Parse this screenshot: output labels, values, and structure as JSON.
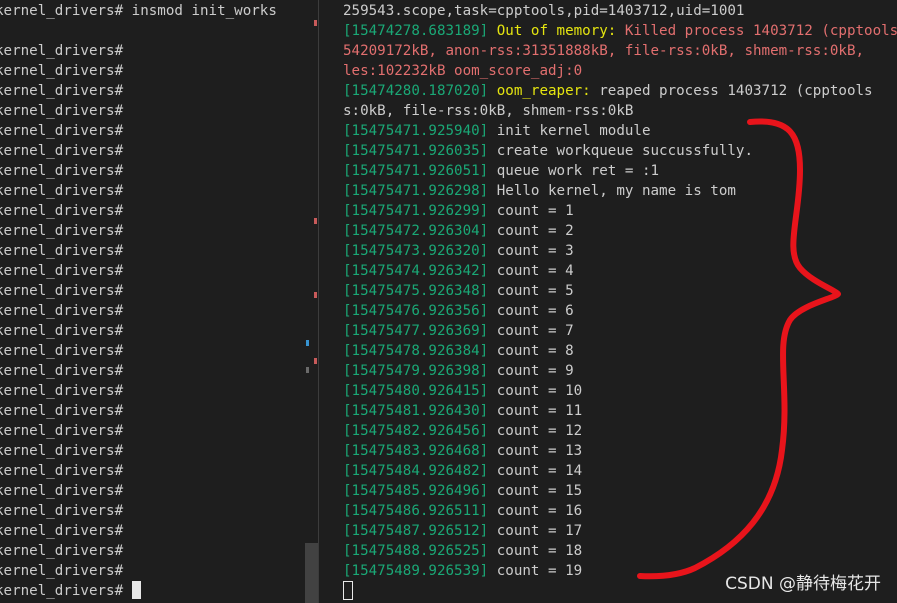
{
  "left_terminal": {
    "lines": [
      "kernel_drivers# insmod init_works",
      "",
      "kernel_drivers#",
      "kernel_drivers#",
      "kernel_drivers#",
      "kernel_drivers#",
      "kernel_drivers#",
      "kernel_drivers#",
      "kernel_drivers#",
      "kernel_drivers#",
      "kernel_drivers#",
      "kernel_drivers#",
      "kernel_drivers#",
      "kernel_drivers#",
      "kernel_drivers#",
      "kernel_drivers#",
      "kernel_drivers#",
      "kernel_drivers#",
      "kernel_drivers#",
      "kernel_drivers#",
      "kernel_drivers#",
      "kernel_drivers#",
      "kernel_drivers#",
      "kernel_drivers#",
      "kernel_drivers#",
      "kernel_drivers#",
      "kernel_drivers#",
      "kernel_drivers#",
      "kernel_drivers#",
      "kernel_drivers#"
    ]
  },
  "right_terminal": {
    "line0": "259543.scope,task=cpptools,pid=1403712,uid=1001",
    "oom_kill": {
      "ts": "[15474278.683189]",
      "label": " Out of memory:",
      "msg": " Killed process 1403712 (cpptools",
      "cont1": "54209172kB, anon-rss:31351888kB, file-rss:0kB, shmem-rss:0kB,",
      "cont2": "les:102232kB oom_score_adj:0"
    },
    "oom_reaper": {
      "ts": "[15474280.187020]",
      "label": " oom_reaper:",
      "msg": " reaped process 1403712 (cpptools",
      "cont": "s:0kB, file-rss:0kB, shmem-rss:0kB"
    },
    "log": [
      {
        "ts": "[15475471.925940]",
        "msg": " init kernel module"
      },
      {
        "ts": "[15475471.926035]",
        "msg": " create workqueue succussfully."
      },
      {
        "ts": "[15475471.926051]",
        "msg": " queue work ret = :1"
      },
      {
        "ts": "[15475471.926298]",
        "msg": " Hello kernel, my name is tom"
      },
      {
        "ts": "[15475471.926299]",
        "msg": " count = 1"
      },
      {
        "ts": "[15475472.926304]",
        "msg": " count = 2"
      },
      {
        "ts": "[15475473.926320]",
        "msg": " count = 3"
      },
      {
        "ts": "[15475474.926342]",
        "msg": " count = 4"
      },
      {
        "ts": "[15475475.926348]",
        "msg": " count = 5"
      },
      {
        "ts": "[15475476.926356]",
        "msg": " count = 6"
      },
      {
        "ts": "[15475477.926369]",
        "msg": " count = 7"
      },
      {
        "ts": "[15475478.926384]",
        "msg": " count = 8"
      },
      {
        "ts": "[15475479.926398]",
        "msg": " count = 9"
      },
      {
        "ts": "[15475480.926415]",
        "msg": " count = 10"
      },
      {
        "ts": "[15475481.926430]",
        "msg": " count = 11"
      },
      {
        "ts": "[15475482.926456]",
        "msg": " count = 12"
      },
      {
        "ts": "[15475483.926468]",
        "msg": " count = 13"
      },
      {
        "ts": "[15475484.926482]",
        "msg": " count = 14"
      },
      {
        "ts": "[15475485.926496]",
        "msg": " count = 15"
      },
      {
        "ts": "[15475486.926511]",
        "msg": " count = 16"
      },
      {
        "ts": "[15475487.926512]",
        "msg": " count = 17"
      },
      {
        "ts": "[15475488.926525]",
        "msg": " count = 18"
      },
      {
        "ts": "[15475489.926539]",
        "msg": " count = 19"
      }
    ]
  },
  "watermark": "CSDN @静待梅花开",
  "colors": {
    "background": "#1e1e1e",
    "timestamp": "#1aa876",
    "error": "#e26f6f",
    "warning": "#e5e510",
    "text": "#cccccc",
    "annotation": "#e8141b"
  }
}
